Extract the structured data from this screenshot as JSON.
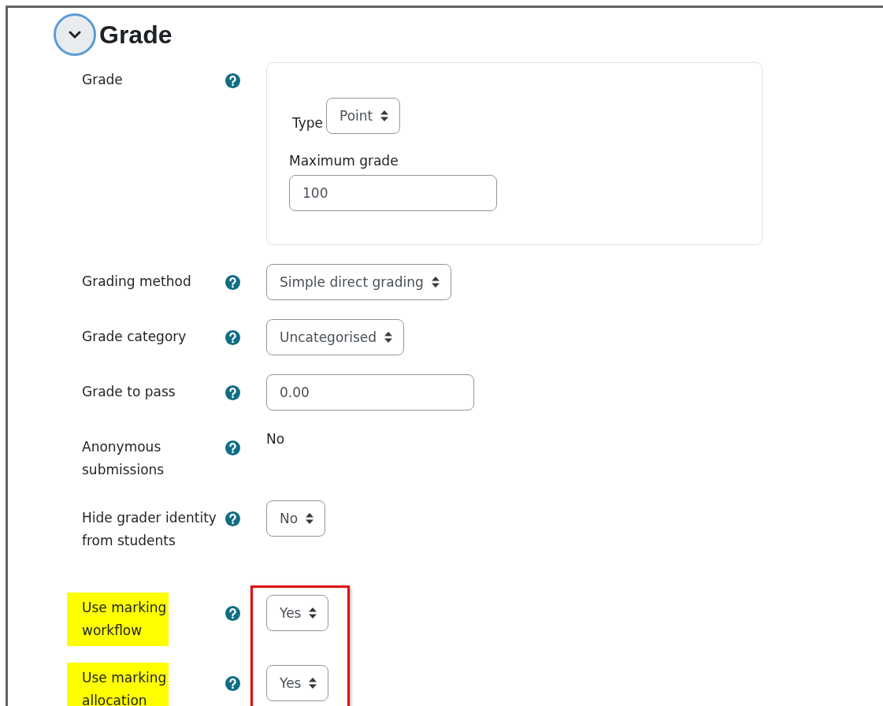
{
  "section": {
    "title": "Grade",
    "expanded": true
  },
  "rows": [
    {
      "kind": "grade-box",
      "label": "Grade",
      "highlighted": false,
      "type_label": "Type",
      "type_value": "Point",
      "max_label": "Maximum grade",
      "max_value": "100"
    },
    {
      "kind": "select",
      "label": "Grading method",
      "highlighted": false,
      "value": "Simple direct grading"
    },
    {
      "kind": "select",
      "label": "Grade category",
      "highlighted": false,
      "value": "Uncategorised"
    },
    {
      "kind": "text",
      "label": "Grade to pass",
      "highlighted": false,
      "value": "0.00"
    },
    {
      "kind": "static",
      "label": "Anonymous submissions",
      "highlighted": false,
      "value": "No"
    },
    {
      "kind": "select",
      "label": "Hide grader identity from students",
      "highlighted": false,
      "value": "No"
    }
  ],
  "boxed_rows": [
    {
      "kind": "select",
      "label": "Use marking workflow",
      "highlighted": true,
      "value": "Yes"
    },
    {
      "kind": "select",
      "label": "Use marking allocation",
      "highlighted": true,
      "value": "Yes"
    }
  ]
}
